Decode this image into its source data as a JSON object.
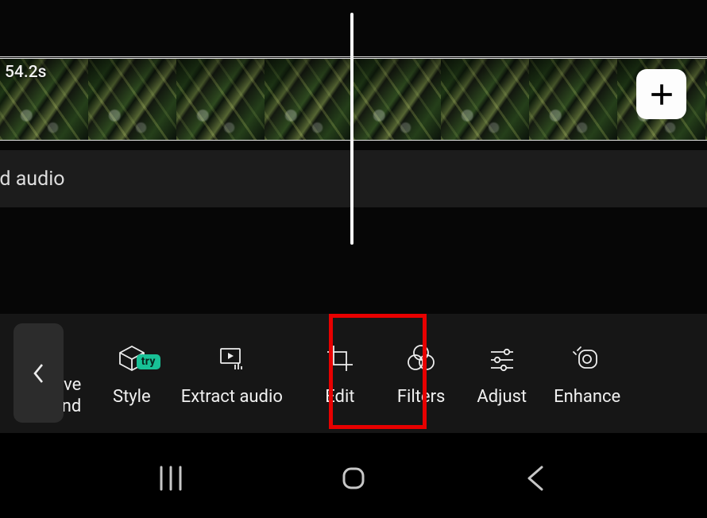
{
  "timeline": {
    "clip_duration_label": "54.2s",
    "audio_strip_label": "Add audio",
    "add_clip_icon": "plus-icon"
  },
  "toolbar": {
    "back_icon": "chevron-left-icon",
    "items": [
      {
        "id": "remove-background",
        "label": "Remove background",
        "visible_label": "ve und",
        "icon": "remove-bg-icon"
      },
      {
        "id": "style",
        "label": "Style",
        "icon": "cube-icon",
        "badge": "try"
      },
      {
        "id": "extract-audio",
        "label": "Extract audio",
        "icon": "extract-audio-icon"
      },
      {
        "id": "edit",
        "label": "Edit",
        "icon": "crop-icon",
        "highlighted": true
      },
      {
        "id": "filters",
        "label": "Filters",
        "icon": "filters-icon"
      },
      {
        "id": "adjust",
        "label": "Adjust",
        "icon": "sliders-icon"
      },
      {
        "id": "enhance",
        "label": "Enhance",
        "icon": "enhance-icon"
      }
    ]
  },
  "nav": {
    "recents": "recents-icon",
    "home": "home-icon",
    "back": "back-icon"
  },
  "annotation": {
    "highlight_target": "edit"
  }
}
